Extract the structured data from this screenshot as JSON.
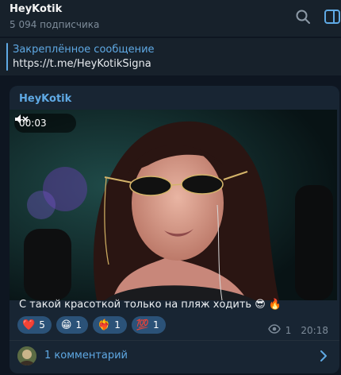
{
  "header": {
    "channel_title": "HeyKotik",
    "subscribers": "5 094 подписчика",
    "icons": [
      "search-icon",
      "sidebar-toggle-icon"
    ]
  },
  "pinned": {
    "title": "Закреплённое сообщение",
    "text": "https://t.me/HeyKotikSigna"
  },
  "message": {
    "author": "HeyKotik",
    "video": {
      "duration": "00:03",
      "muted": true
    },
    "caption": "С такой красоткой только на пляж ходить 😎 🔥",
    "reactions": [
      {
        "emoji": "❤️",
        "count": "5"
      },
      {
        "emoji": "😁",
        "count": "1"
      },
      {
        "emoji": "❤️‍🔥",
        "count": "1"
      },
      {
        "emoji": "💯",
        "count": "1"
      }
    ],
    "views": "1",
    "time": "20:18"
  },
  "comments": {
    "label": "1 комментарий"
  },
  "colors": {
    "background": "#0e1621",
    "panel": "#17212b",
    "bubble": "#182533",
    "accent": "#5fa9e4",
    "reaction_bg": "#2b5278"
  }
}
